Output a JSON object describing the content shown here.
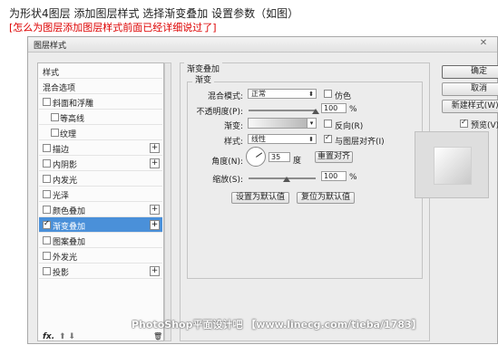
{
  "caption": {
    "line1": "为形状4图层 添加图层样式 选择渐变叠加 设置参数（如图）",
    "line2": "[怎么为图层添加图层样式前面已经详细说过了]"
  },
  "dialog": {
    "title": "图层样式",
    "close_glyph": "✕"
  },
  "sidebar": {
    "items": [
      {
        "label": "样式"
      },
      {
        "label": "混合选项"
      },
      {
        "label": "斜面和浮雕"
      },
      {
        "label": "等高线"
      },
      {
        "label": "纹理"
      },
      {
        "label": "描边"
      },
      {
        "label": "内阴影"
      },
      {
        "label": "内发光"
      },
      {
        "label": "光泽"
      },
      {
        "label": "颜色叠加"
      },
      {
        "label": "渐变叠加"
      },
      {
        "label": "图案叠加"
      },
      {
        "label": "外发光"
      },
      {
        "label": "投影"
      }
    ],
    "fx_label": "fx.",
    "arrows": "⬆ ⬇",
    "trash_glyph": "🗑"
  },
  "panel": {
    "group_title": "渐变叠加",
    "sub_title": "渐变",
    "blend_mode_label": "混合模式:",
    "blend_mode_value": "正常",
    "dither_label": "仿色",
    "opacity_label": "不透明度(P):",
    "opacity_value": "100",
    "opacity_unit": "%",
    "gradient_label": "渐变:",
    "reverse_label": "反向(R)",
    "style_label": "样式:",
    "style_value": "线性",
    "align_label": "与图层对齐(I)",
    "angle_label": "角度(N):",
    "angle_value": "35",
    "angle_unit": "度",
    "reset_align_label": "重置对齐",
    "scale_label": "缩放(S):",
    "scale_value": "100",
    "scale_unit": "%",
    "make_default_label": "设置为默认值",
    "reset_default_label": "复位为默认值"
  },
  "right": {
    "ok_label": "确定",
    "cancel_label": "取消",
    "new_style_label": "新建样式(W)...",
    "preview_label": "预览(V)"
  },
  "watermark": "PhotoShop平面设计吧 【www.linecg.com/tieba/1783】"
}
